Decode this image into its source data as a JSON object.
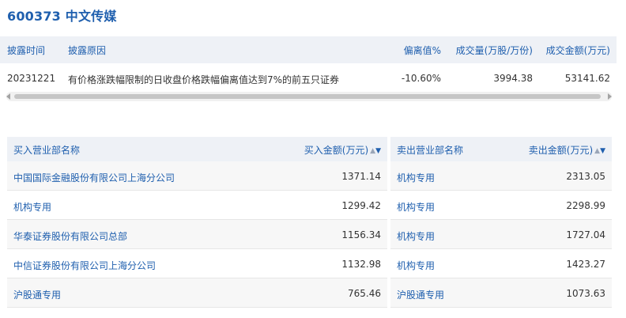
{
  "header": {
    "title": "600373 中文传媒"
  },
  "disclosure": {
    "columns": {
      "date": "披露时间",
      "reason": "披露原因",
      "deviation": "偏离值%",
      "volume": "成交量(万股/万份)",
      "amount": "成交金额(万元)"
    },
    "row": {
      "date": "20231221",
      "reason": "有价格涨跌幅限制的日收盘价格跌幅偏离值达到7%的前五只证券",
      "deviation": "-10.60%",
      "volume": "3994.38",
      "amount": "53141.62"
    }
  },
  "buy_table": {
    "header_label": "买入营业部名称",
    "header_amount": "买入金额(万元)",
    "rows": [
      {
        "name": "中国国际金融股份有限公司上海分公司",
        "amount": "1371.14"
      },
      {
        "name": "机构专用",
        "amount": "1299.42"
      },
      {
        "name": "华泰证券股份有限公司总部",
        "amount": "1156.34"
      },
      {
        "name": "中信证券股份有限公司上海分公司",
        "amount": "1132.98"
      },
      {
        "name": "沪股通专用",
        "amount": "765.46"
      }
    ]
  },
  "sell_table": {
    "header_label": "卖出营业部名称",
    "header_amount": "卖出金额(万元)",
    "rows": [
      {
        "name": "机构专用",
        "amount": "2313.05"
      },
      {
        "name": "机构专用",
        "amount": "2298.99"
      },
      {
        "name": "机构专用",
        "amount": "1727.04"
      },
      {
        "name": "机构专用",
        "amount": "1423.27"
      },
      {
        "name": "沪股通专用",
        "amount": "1073.63"
      }
    ]
  },
  "sort_icons": {
    "up": "▲",
    "down": "▼"
  },
  "colors": {
    "accent": "#1f5fae",
    "header_bg": "#eef1f6",
    "row_alt": "#f7f7f7"
  }
}
